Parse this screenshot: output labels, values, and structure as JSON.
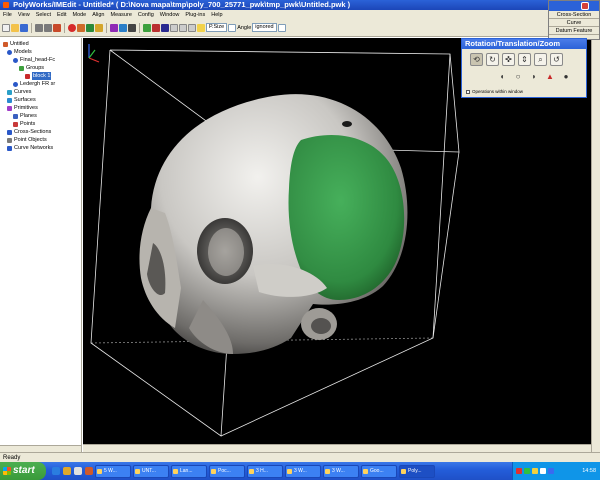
{
  "window": {
    "title": "PolyWorks/IMEdit - Untitled* ( D:\\Nova mapa\\tmp\\poly_700_25771_pwk\\tmp_pwk\\Untitled.pwk )"
  },
  "menu": [
    "File",
    "View",
    "Select",
    "Edit",
    "Mode",
    "Align",
    "Measure",
    "Config",
    "Window",
    "Plug-ins",
    "Help"
  ],
  "toolbar": {
    "pixel_field": "P.Size",
    "angle_label": "Angle",
    "angle_value": "ignored"
  },
  "tree": {
    "items": [
      {
        "label": "Untitled",
        "selected": false
      },
      {
        "label": "Models",
        "selected": false
      },
      {
        "label": "Final_head-Fc",
        "selected": false
      },
      {
        "label": "Groups",
        "selected": false
      },
      {
        "label": "block 1",
        "selected": true
      },
      {
        "label": "Ledergh FR sr",
        "selected": false
      },
      {
        "label": "Curves",
        "selected": false
      },
      {
        "label": "Surfaces",
        "selected": false
      },
      {
        "label": "Primitives",
        "selected": false
      },
      {
        "label": "Planes",
        "selected": false
      },
      {
        "label": "Points",
        "selected": false
      },
      {
        "label": "Cross-Sections",
        "selected": false
      },
      {
        "label": "Point Objects",
        "selected": false
      },
      {
        "label": "Curve Networks",
        "selected": false
      }
    ]
  },
  "dock": {
    "items": [
      "Cross-Section",
      "Curve",
      "Datum Feature"
    ]
  },
  "palette": {
    "title": "Rotation/Translation/Zoom",
    "option": "Operations within window"
  },
  "status": "Ready",
  "taskbar": {
    "start_label": "start",
    "tasks": [
      "5 W...",
      "UNT...",
      "Lan...",
      "Poc...",
      "3 H...",
      "3 W...",
      "3 W...",
      "Goo...",
      "Poly..."
    ],
    "clock": "14:58"
  },
  "colors": {
    "titlebar": "#1c46b8",
    "view_bg": "#000000",
    "green_surface": "#2e8b3d",
    "skull": "#d8d6d2"
  }
}
